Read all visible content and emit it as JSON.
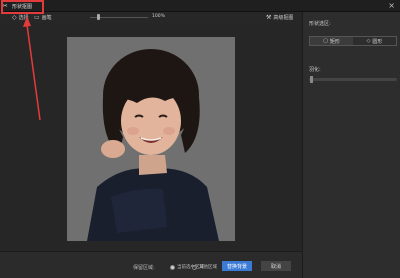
{
  "window": {
    "title": "形状抠图",
    "close_glyph": "×"
  },
  "toolbar": {
    "select": "选择",
    "brush": "画笔",
    "slider_value": "100%",
    "auto_label": "高级抠图",
    "slider_fraction": 0.15
  },
  "right_panel": {
    "shape_select_label": "形状选区:",
    "rect_label": "矩形",
    "circle_label": "圆形",
    "feather_label": "羽化:"
  },
  "bottom": {
    "region_label": "保留区域:",
    "option_current": "当前选中区域",
    "option_other": "其他区域",
    "apply_label": "替换背景",
    "cancel_label": "取消"
  },
  "colors": {
    "accent": "#3b7bd6",
    "annotation": "#e23b3b"
  }
}
